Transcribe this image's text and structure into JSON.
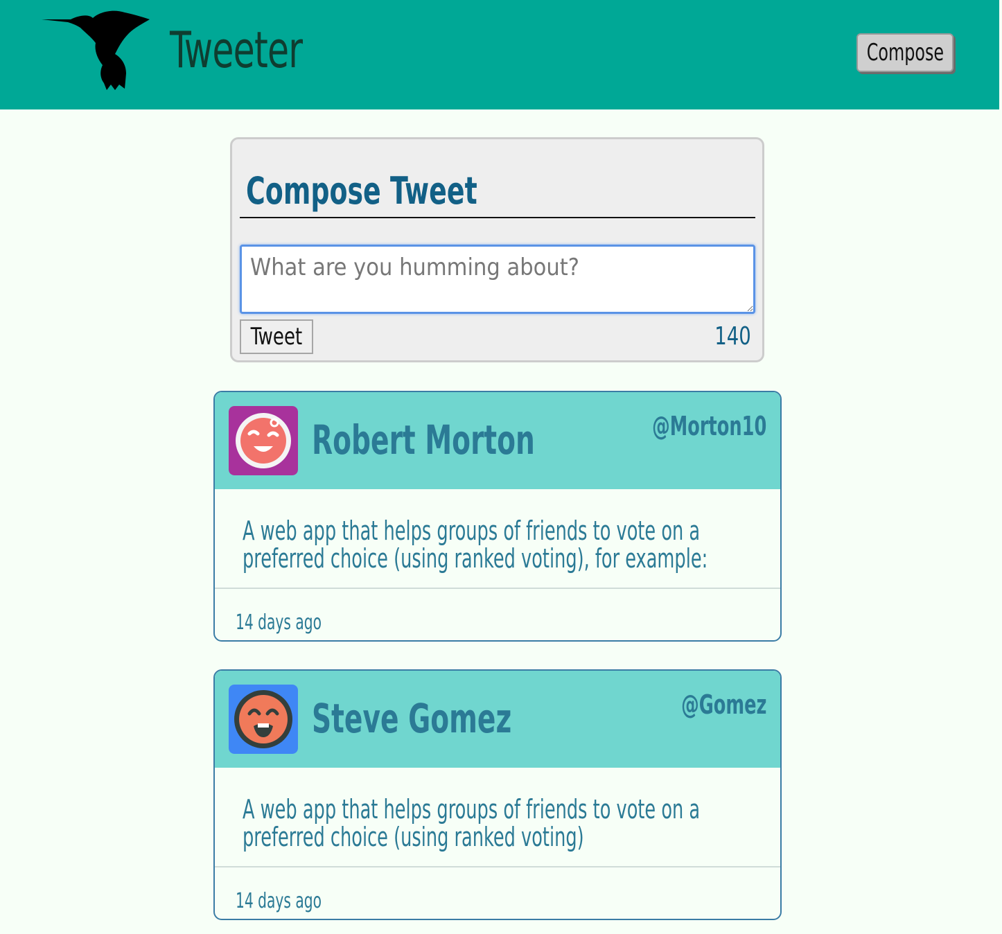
{
  "header": {
    "brand": "Tweeter",
    "compose_label": "Compose",
    "colors": {
      "bar": "#00a896",
      "brand_text": "#0f3d30"
    }
  },
  "composer": {
    "title": "Compose Tweet",
    "placeholder": "What are you humming about?",
    "value": "",
    "submit_label": "Tweet",
    "char_count": "140"
  },
  "tweets": [
    {
      "name": "Robert Morton",
      "handle": "@Morton10",
      "content_lines": [
        "A web app that helps groups of friends to vote on a",
        "preferred choice (using ranked voting), for example:"
      ],
      "time": "14 days ago",
      "avatar": {
        "icon": "laughing-face-avatar",
        "bg": "#a8329c",
        "face": "#f2736b"
      }
    },
    {
      "name": "Steve Gomez",
      "handle": "@Gomez",
      "content_lines": [
        "A web app that helps groups of friends to vote on a",
        "preferred choice (using ranked voting)"
      ],
      "time": "14 days ago",
      "avatar": {
        "icon": "happy-face-avatar",
        "bg": "#3f87f5",
        "face": "#f07a5a"
      }
    }
  ]
}
